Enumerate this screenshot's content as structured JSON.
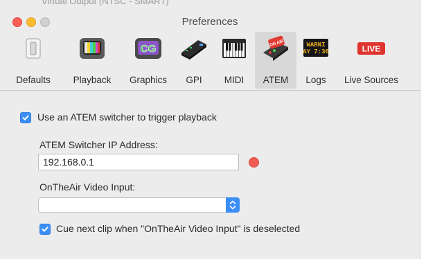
{
  "behind_window_text": "Virtual Output (NTSC - SMART)",
  "window": {
    "title": "Preferences"
  },
  "toolbar": {
    "items": [
      {
        "label": "Defaults",
        "icon": "switch-icon"
      },
      {
        "label": "Playback",
        "icon": "tv-icon"
      },
      {
        "label": "Graphics",
        "icon": "cg-icon"
      },
      {
        "label": "GPI",
        "icon": "gpi-box-icon"
      },
      {
        "label": "MIDI",
        "icon": "piano-keyboard-icon"
      },
      {
        "label": "ATEM",
        "icon": "atem-switcher-icon",
        "selected": true
      },
      {
        "label": "Logs",
        "icon": "warning-sign-icon"
      },
      {
        "label": "Live Sources",
        "icon": "live-icon"
      }
    ],
    "graphics_icon_text": "CG",
    "logs_icon_text": [
      "WARNI",
      "AY 7:36"
    ],
    "live_icon_text": "LIVE",
    "atem_icon_text": "ON AIR"
  },
  "atem": {
    "use_switcher": {
      "label": "Use an ATEM switcher to trigger playback",
      "checked": true
    },
    "ip_label": "ATEM Switcher IP Address:",
    "ip_value": "192.168.0.1",
    "ip_status_color": "#f15b54",
    "video_input_label": "OnTheAir Video Input:",
    "video_input_value": "",
    "cue_next": {
      "label": "Cue next clip when \"OnTheAir Video Input\" is deselected",
      "checked": true
    }
  },
  "colors": {
    "accent": "#3a8ef6",
    "status_red": "#f15b54"
  }
}
